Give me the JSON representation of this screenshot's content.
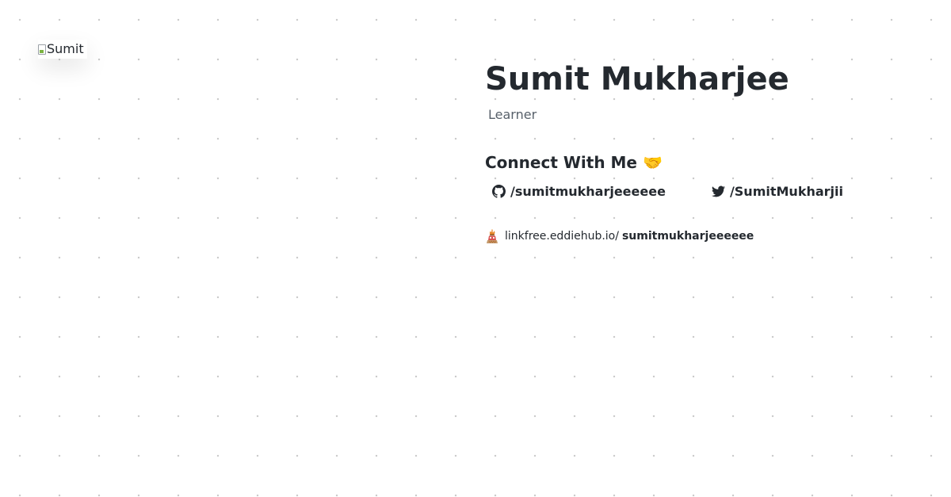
{
  "profile": {
    "avatar_alt": "Sumit",
    "name": "Sumit Mukharjee",
    "bio": "Learner"
  },
  "connect": {
    "heading": "Connect With Me 🤝",
    "github_label": "/sumitmukharjeeeeee",
    "twitter_label": "/SumitMukharjii"
  },
  "linkfree": {
    "domain": "linkfree.eddiehub.io/",
    "handle": "sumitmukharjeeeeee"
  },
  "icons": {
    "github": "github-icon",
    "twitter": "twitter-icon",
    "linkfree": "linkfree-logo-icon",
    "broken_image": "broken-image-icon"
  }
}
